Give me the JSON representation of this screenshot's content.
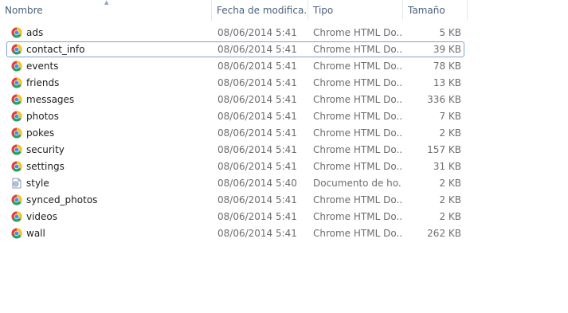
{
  "columns": {
    "name": "Nombre",
    "date": "Fecha de modifica...",
    "type": "Tipo",
    "size": "Tamaño"
  },
  "files": [
    {
      "name": "ads",
      "date": "08/06/2014 5:41",
      "type": "Chrome HTML Do...",
      "size": "5 KB",
      "icon": "chrome-icon"
    },
    {
      "name": "contact_info",
      "date": "08/06/2014 5:41",
      "type": "Chrome HTML Do...",
      "size": "39 KB",
      "icon": "chrome-icon",
      "focused": true
    },
    {
      "name": "events",
      "date": "08/06/2014 5:41",
      "type": "Chrome HTML Do...",
      "size": "78 KB",
      "icon": "chrome-icon"
    },
    {
      "name": "friends",
      "date": "08/06/2014 5:41",
      "type": "Chrome HTML Do...",
      "size": "13 KB",
      "icon": "chrome-icon"
    },
    {
      "name": "messages",
      "date": "08/06/2014 5:41",
      "type": "Chrome HTML Do...",
      "size": "336 KB",
      "icon": "chrome-icon"
    },
    {
      "name": "photos",
      "date": "08/06/2014 5:41",
      "type": "Chrome HTML Do...",
      "size": "7 KB",
      "icon": "chrome-icon"
    },
    {
      "name": "pokes",
      "date": "08/06/2014 5:41",
      "type": "Chrome HTML Do...",
      "size": "2 KB",
      "icon": "chrome-icon"
    },
    {
      "name": "security",
      "date": "08/06/2014 5:41",
      "type": "Chrome HTML Do...",
      "size": "157 KB",
      "icon": "chrome-icon"
    },
    {
      "name": "settings",
      "date": "08/06/2014 5:41",
      "type": "Chrome HTML Do...",
      "size": "31 KB",
      "icon": "chrome-icon"
    },
    {
      "name": "style",
      "date": "08/06/2014 5:40",
      "type": "Documento de ho...",
      "size": "2 KB",
      "icon": "stylesheet-file-icon"
    },
    {
      "name": "synced_photos",
      "date": "08/06/2014 5:41",
      "type": "Chrome HTML Do...",
      "size": "2 KB",
      "icon": "chrome-icon"
    },
    {
      "name": "videos",
      "date": "08/06/2014 5:41",
      "type": "Chrome HTML Do...",
      "size": "2 KB",
      "icon": "chrome-icon"
    },
    {
      "name": "wall",
      "date": "08/06/2014 5:41",
      "type": "Chrome HTML Do...",
      "size": "262 KB",
      "icon": "chrome-icon"
    }
  ],
  "colors": {
    "header_text": "#4c607a",
    "focus_border": "#7da2ce",
    "secondary_text": "#6d6d6d"
  }
}
